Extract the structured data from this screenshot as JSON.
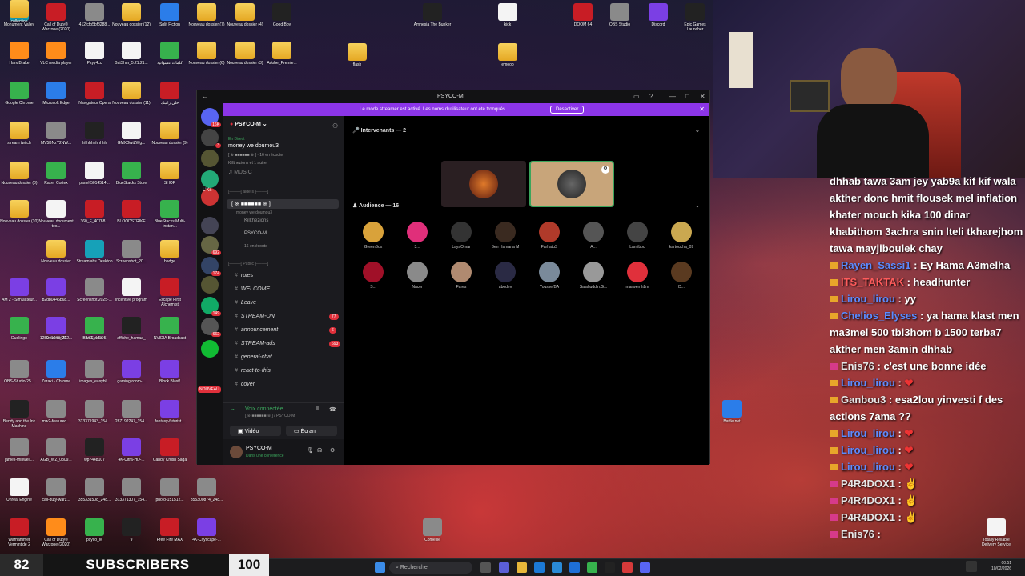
{
  "desktop_icons": [
    {
      "label": "Monument Valley",
      "c": "app7"
    },
    {
      "label": "Call of Duty® Warzone (2020)",
      "c": "app1"
    },
    {
      "label": "412fcfb5bf8288...",
      "c": "app8"
    },
    {
      "label": "Nouveau dossier (12)",
      "c": "folder"
    },
    {
      "label": "Split Fiction",
      "c": "app2"
    },
    {
      "label": "Nouveau dossier (7)",
      "c": "folder"
    },
    {
      "label": "Nouveau dossier (4)",
      "c": "folder"
    },
    {
      "label": "Good Boy",
      "c": "app5"
    },
    {
      "label": "HandBrake",
      "c": "app6"
    },
    {
      "label": "VLC media player",
      "c": "app6"
    },
    {
      "label": "Psyy4cc",
      "c": "file"
    },
    {
      "label": "BatShm_5.21.21...",
      "c": "file"
    },
    {
      "label": "كلمات عشوائية",
      "c": "app3"
    },
    {
      "label": "Nouveau dossier (6)",
      "c": "folder"
    },
    {
      "label": "Nouveau dossier (3)",
      "c": "folder"
    },
    {
      "label": "Adobe_Premie...",
      "c": "folder"
    },
    {
      "label": "Google Chrome",
      "c": "app3"
    },
    {
      "label": "Microsoft Edge",
      "c": "app2"
    },
    {
      "label": "Navigateur Opera",
      "c": "app1"
    },
    {
      "label": "Nouveau dossier (11)",
      "c": "folder"
    },
    {
      "label": "خلي راسك",
      "c": "app1"
    },
    {
      "label": "stream twitch",
      "c": "folder"
    },
    {
      "label": "MV5BNzY2NW...",
      "c": "app8"
    },
    {
      "label": "hhhhhhhhhhh",
      "c": "app5"
    },
    {
      "label": "GMXGwiZWg...",
      "c": "file"
    },
    {
      "label": "Nouveau dossier (9)",
      "c": "folder"
    },
    {
      "label": "Nouveau dossier (8)",
      "c": "folder"
    },
    {
      "label": "Razer Cortex",
      "c": "app3"
    },
    {
      "label": "panel-5014514...",
      "c": "file"
    },
    {
      "label": "BlueStacks Store",
      "c": "app3"
    },
    {
      "label": "SHOP",
      "c": "folder"
    },
    {
      "label": "Nouveau dossier (10)",
      "c": "folder"
    },
    {
      "label": "Nouveau document tex...",
      "c": "file"
    },
    {
      "label": "360_F_40788...",
      "c": "app1"
    },
    {
      "label": "BLOODSTRIKE",
      "c": "app1"
    },
    {
      "label": "BlueStacks Multi-Instan...",
      "c": "app3"
    },
    {
      "label": "Nouveau dossier",
      "c": "folder"
    },
    {
      "label": "Streamlabs Desktop",
      "c": "app7"
    },
    {
      "label": "Screenshot_20...",
      "c": "app8"
    },
    {
      "label": "badge",
      "c": "folder"
    },
    {
      "label": "AM 2 - Simulateur...",
      "c": "app4"
    },
    {
      "label": "b2db0446b6b...",
      "c": "app4"
    },
    {
      "label": "Screenshot 2025-...",
      "c": "app8"
    },
    {
      "label": "incentive program",
      "c": "file"
    },
    {
      "label": "Escape First Alchemist",
      "c": "app1"
    },
    {
      "label": "Duolingo",
      "c": "app3"
    },
    {
      "label": "IMG_4429",
      "c": "app8"
    },
    {
      "label": "affiche_hamaa_",
      "c": "app5"
    },
    {
      "label": "NVIDIA Broadcast",
      "c": "app3"
    },
    {
      "label": "SandboxUE",
      "c": "app6"
    },
    {
      "label": "125941043_212...",
      "c": "app4"
    },
    {
      "label": "BlueStacks 5",
      "c": "app3"
    },
    {
      "label": "OBS-Studio-25...",
      "c": "app8"
    },
    {
      "label": "Zaraki - Chrome",
      "c": "app2"
    },
    {
      "label": "images_easybl...",
      "c": "app8"
    },
    {
      "label": "gaming-room-...",
      "c": "app4"
    },
    {
      "label": "Block Blast!",
      "c": "app4"
    },
    {
      "label": "Bendy and the Ink Machine",
      "c": "app5"
    },
    {
      "label": "mw2-featured...",
      "c": "app8"
    },
    {
      "label": "313371943_154...",
      "c": "app8"
    },
    {
      "label": "287192247_154...",
      "c": "app8"
    },
    {
      "label": "fantasy-futurist...",
      "c": "app4"
    },
    {
      "label": "james-thirlwell...",
      "c": "app8"
    },
    {
      "label": "AGB_WZ_0309...",
      "c": "app8"
    },
    {
      "label": "wp7448107",
      "c": "app5"
    },
    {
      "label": "4K-Ultra-HD-...",
      "c": "app4"
    },
    {
      "label": "Candy Crush Saga",
      "c": "app1"
    },
    {
      "label": "Unreal Engine",
      "c": "file"
    },
    {
      "label": "call-duty-warz...",
      "c": "app8"
    },
    {
      "label": "355331508_248...",
      "c": "app8"
    },
    {
      "label": "313371307_154...",
      "c": "app8"
    },
    {
      "label": "photo-151512...",
      "c": "app8"
    },
    {
      "label": "355300874_248...",
      "c": "app8"
    },
    {
      "label": "Warhammer Vermintide 2",
      "c": "app1"
    },
    {
      "label": "Call of Duty® Warzone (2020)",
      "c": "app6"
    },
    {
      "label": "psyco_M",
      "c": "app3"
    },
    {
      "label": "9",
      "c": "app5"
    },
    {
      "label": "Free Fire MAX",
      "c": "app1"
    },
    {
      "label": "4K-Cityscape-...",
      "c": "app4"
    },
    {
      "label": "Amnesia The Bunker",
      "c": "app5"
    },
    {
      "label": "kick",
      "c": "file"
    },
    {
      "label": "emooo",
      "c": "folder"
    },
    {
      "label": "flash",
      "c": "folder"
    },
    {
      "label": "DOOM 64",
      "c": "app1"
    },
    {
      "label": "OBS Studio",
      "c": "app8"
    },
    {
      "label": "Discord",
      "c": "app4"
    },
    {
      "label": "Epic Games Launcher",
      "c": "app5"
    },
    {
      "label": "Battle.net",
      "c": "app2"
    },
    {
      "label": "Totally Reliable Delivery Service",
      "c": "file"
    },
    {
      "label": "Corbeille",
      "c": "app8"
    },
    {
      "label": "collection",
      "c": "folder"
    }
  ],
  "discord": {
    "title": "PSYCO-M",
    "streamer_msg": "Le mode streamer est activé. Les noms d'utilisateur ont été tronqués.",
    "streamer_btn": "Désactiver",
    "server_name": "PSYCO-M",
    "live_label": "En Direct",
    "event_name": "money we doumou3",
    "event_sub": "[ ※ ■■■■■■ ※ ] · 16 en écoute",
    "event_sub2": "Killthezions et 1 autre",
    "music": "MUSIC",
    "cat_top": "[────[ aide-s ]────]",
    "stage_name": "[ ※ ■■■■■■ ※ ]",
    "stage_sub": "money we doumou3",
    "stage_u1": "Killthezions",
    "stage_u2": "PSYCO-M",
    "stage_u3": "16 en écoute",
    "cat_public": "[────[ Public ]────]",
    "channels": [
      {
        "name": "rules",
        "badge": ""
      },
      {
        "name": "WELCOME",
        "badge": ""
      },
      {
        "name": "Leave",
        "badge": ""
      },
      {
        "name": "STREAM-ON",
        "badge": "77"
      },
      {
        "name": "announcement",
        "badge": "6"
      },
      {
        "name": "STREAM-ads",
        "badge": "693"
      },
      {
        "name": "general-chat",
        "badge": ""
      },
      {
        "name": "react-to-this",
        "badge": ""
      },
      {
        "name": "cover",
        "badge": ""
      }
    ],
    "voice_connected": "Voix connectée",
    "voice_sub": "[ ※ ■■■■■■ ※ ] / PSYCO-M",
    "video_btn": "Vidéo",
    "screen_btn": "Écran",
    "user_name": "PSYCO-M",
    "user_status": "Dans une conférence",
    "speakers_label": "Intervenants — 2",
    "audience_label": "Audience — 16",
    "new_label": "NOUVEAU",
    "lks": "L'Ks",
    "server_badges": [
      "16K",
      "3",
      "",
      "",
      "",
      "",
      "692",
      "174",
      "",
      "149",
      "662",
      ""
    ],
    "audience": [
      {
        "name": "GreenBox",
        "c": "#d9a23a"
      },
      {
        "name": "3...",
        "c": "#e02f7a"
      },
      {
        "name": "LayaOmar",
        "c": "#333"
      },
      {
        "name": "Ben Hamana M",
        "c": "#3a2a20"
      },
      {
        "name": "FarhatuS",
        "c": "#b03a2a"
      },
      {
        "name": "A...",
        "c": "#555"
      },
      {
        "name": "Larnibou",
        "c": "#444"
      },
      {
        "name": "kartoucha_09",
        "c": "#caa850"
      },
      {
        "name": "S...",
        "c": "#a01028"
      },
      {
        "name": "Nacer",
        "c": "#8a8a8a"
      },
      {
        "name": "Fares",
        "c": "#b08a70"
      },
      {
        "name": "abodev",
        "c": "#2a2a44"
      },
      {
        "name": "YoussefBA",
        "c": "#7a8a9a"
      },
      {
        "name": "Salahuddin.G...",
        "c": "#999"
      },
      {
        "name": "marwen h2m",
        "c": "#e0303b"
      },
      {
        "name": "D...",
        "c": "#5a3a20"
      }
    ]
  },
  "chat": [
    {
      "user": "",
      "text": "dhhab tawa 3am jey yab9a kif kif wala"
    },
    {
      "user": "",
      "text": "akther donc hmit flousek mel inflation"
    },
    {
      "user": "",
      "text": "khater mouch kika 100 dinar"
    },
    {
      "user": "",
      "text": "khabithom 3achra snin lteli tkharejhom"
    },
    {
      "user": "",
      "text": "tawa mayjiboulek chay"
    },
    {
      "user": "Rayen_Sassi1",
      "text": ": Ey Hama A3melha"
    },
    {
      "user": "ITS_TAKTAK",
      "text": ": headhunter"
    },
    {
      "user": "Lirou_lirou",
      "text": ": yy"
    },
    {
      "user": "Chelios_Elyses",
      "text": ": ya hama klast men"
    },
    {
      "user": "",
      "text": "ma3mel 500 tbi3hom b 1500 terba7"
    },
    {
      "user": "",
      "text": "akther men 3amin dhhab"
    },
    {
      "user": "Enis76",
      "text": ": c'est une bonne idée"
    },
    {
      "user": "Lirou_lirou",
      "text": ":"
    },
    {
      "user": "Ganbou3",
      "text": ": esa2lou yinvesti f des"
    },
    {
      "user": "",
      "text": "actions 7ama ??"
    },
    {
      "user": "Lirou_lirou",
      "text": ":"
    },
    {
      "user": "Lirou_lirou",
      "text": ":"
    },
    {
      "user": "Lirou_lirou",
      "text": ":"
    },
    {
      "user": "P4R4DOX1",
      "text": ":"
    },
    {
      "user": "P4R4DOX1",
      "text": ":"
    },
    {
      "user": "P4R4DOX1",
      "text": ":"
    },
    {
      "user": "Enis76",
      "text": ":"
    }
  ],
  "subs": {
    "current": "82",
    "label": "SUBSCRIBERS",
    "goal": "100"
  },
  "taskbar": {
    "search": "Rechercher",
    "time": "00:51",
    "date": "10/02/2026"
  }
}
